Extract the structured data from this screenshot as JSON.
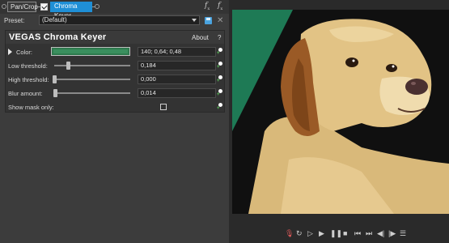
{
  "chain": {
    "pan_crop_label": "Pan/Crop",
    "chroma_keyer_label": "Chroma Keyer",
    "chroma_keyer_enabled": true,
    "chroma_keyer_accent": "#1f8fd6"
  },
  "preset": {
    "label": "Preset:",
    "value": "(Default)"
  },
  "plugin": {
    "title": "VEGAS Chroma Keyer",
    "about_label": "About",
    "help_label": "?",
    "params": {
      "color": {
        "label": "Color:",
        "value": "140; 0,64; 0,48",
        "swatch_color": "#2f7a4e"
      },
      "low_threshold": {
        "label": "Low threshold:",
        "value": "0,184",
        "level": 0.184
      },
      "high_threshold": {
        "label": "High threshold:",
        "value": "0,000",
        "level": 0.0
      },
      "blur_amount": {
        "label": "Blur amount:",
        "value": "0,014",
        "level": 0.014
      },
      "show_mask_only": {
        "label": "Show mask only:",
        "checked": false
      }
    }
  },
  "icons": {
    "fx_chain": "fx-chain-icon",
    "fx_remove": "fx-remove-icon",
    "save_preset": "save-preset-icon",
    "delete_preset": "delete-preset-icon",
    "keyframe": "keyframe-animate-icon"
  },
  "preview": {
    "background_color": "#1e7a55",
    "subject": "labrador-dog"
  }
}
